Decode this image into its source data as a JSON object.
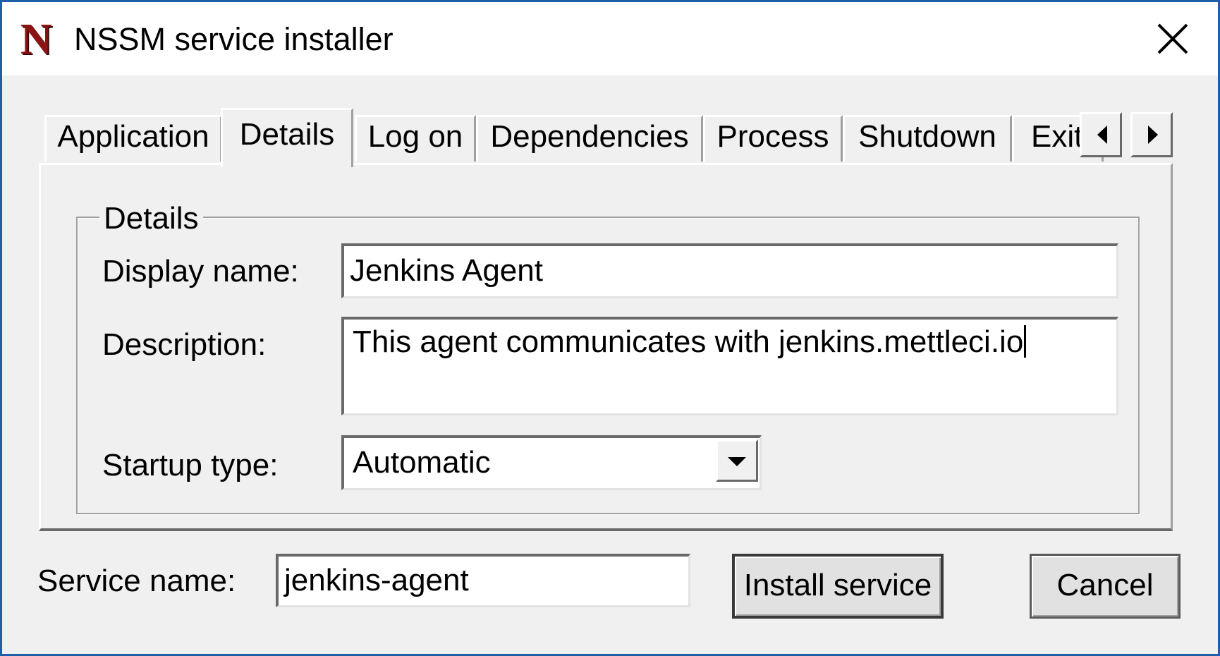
{
  "window": {
    "title": "NSSM service installer",
    "icon": "nssm-logo-icon",
    "icon_letter": "N",
    "accent_color": "#1f5fa8",
    "icon_color": "#8a1414"
  },
  "tabs": [
    {
      "label": "Application",
      "active": false
    },
    {
      "label": "Details",
      "active": true
    },
    {
      "label": "Log on",
      "active": false
    },
    {
      "label": "Dependencies",
      "active": false
    },
    {
      "label": "Process",
      "active": false
    },
    {
      "label": "Shutdown",
      "active": false
    },
    {
      "label": "Exit",
      "active": false
    }
  ],
  "tab_scroll": {
    "left_icon": "triangle-left-icon",
    "right_icon": "triangle-right-icon"
  },
  "details": {
    "group_label": "Details",
    "display_name_label": "Display name:",
    "display_name_value": "Jenkins Agent",
    "description_label": "Description:",
    "description_value": "This agent communicates with jenkins.mettleci.io",
    "startup_type_label": "Startup type:",
    "startup_type_value": "Automatic"
  },
  "footer": {
    "service_name_label": "Service name:",
    "service_name_value": "jenkins-agent",
    "install_button": "Install service",
    "cancel_button": "Cancel"
  }
}
